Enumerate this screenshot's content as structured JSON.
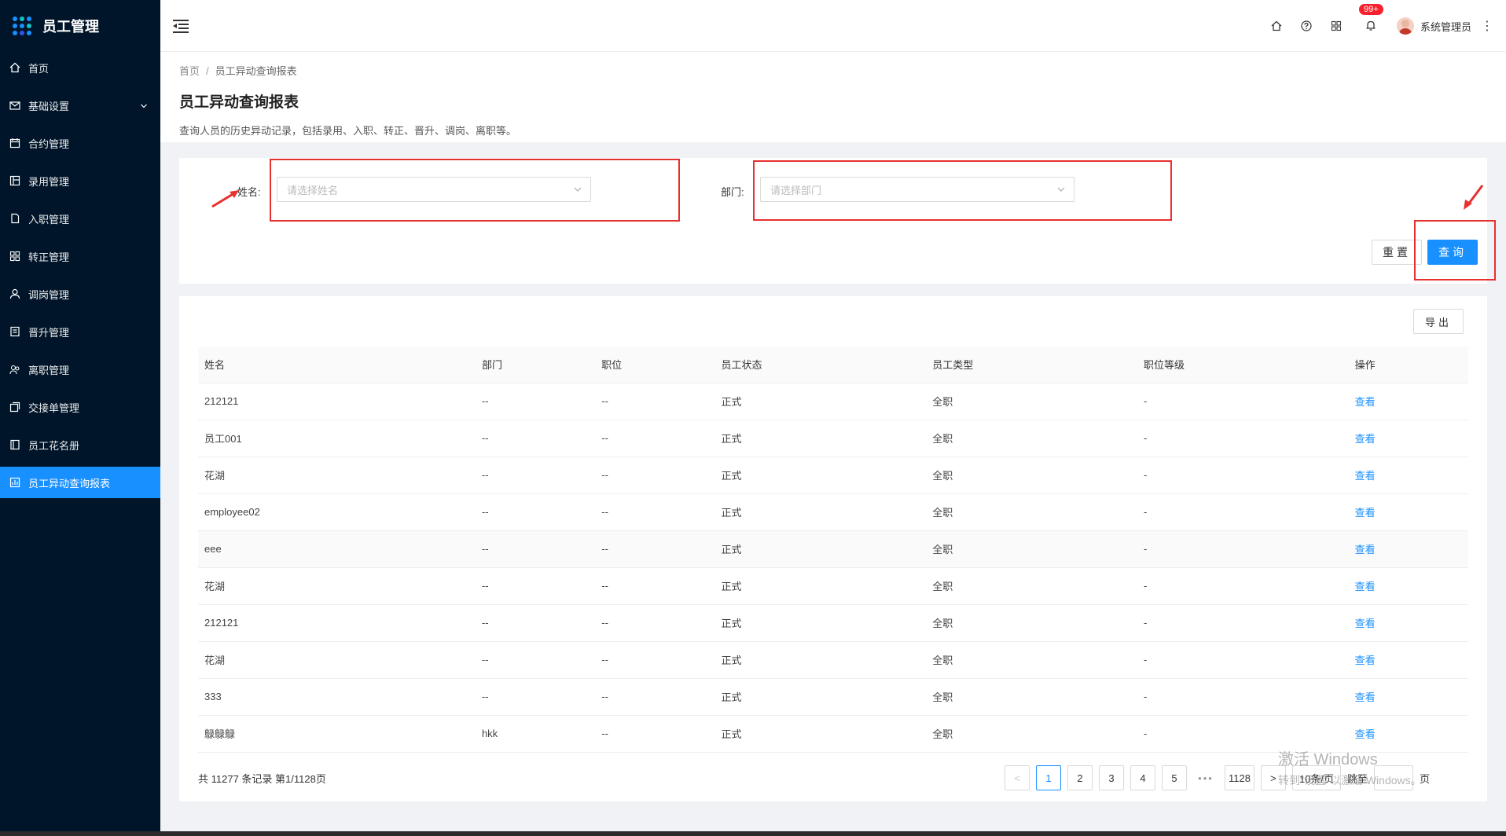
{
  "app": {
    "title": "员工管理"
  },
  "sidebar": {
    "items": [
      {
        "label": "首页",
        "icon": "home-icon"
      },
      {
        "label": "基础设置",
        "icon": "mail-icon",
        "expandable": true
      },
      {
        "label": "合约管理",
        "icon": "calendar-icon"
      },
      {
        "label": "录用管理",
        "icon": "layout-icon"
      },
      {
        "label": "入职管理",
        "icon": "file-icon"
      },
      {
        "label": "转正管理",
        "icon": "grid-icon"
      },
      {
        "label": "调岗管理",
        "icon": "user-icon"
      },
      {
        "label": "晋升管理",
        "icon": "profile-icon"
      },
      {
        "label": "离职管理",
        "icon": "team-icon"
      },
      {
        "label": "交接单管理",
        "icon": "copy-icon"
      },
      {
        "label": "员工花名册",
        "icon": "book-icon"
      },
      {
        "label": "员工异动查询报表",
        "icon": "report-icon",
        "active": true
      }
    ]
  },
  "header": {
    "badge": "99+",
    "username": "系统管理员"
  },
  "breadcrumb": {
    "home": "首页",
    "current": "员工异动查询报表"
  },
  "page": {
    "title": "员工异动查询报表",
    "description": "查询人员的历史异动记录，包括录用、入职、转正、晋升、调岗、离职等。"
  },
  "search": {
    "name_label": "姓名:",
    "name_placeholder": "请选择姓名",
    "dept_label": "部门:",
    "dept_placeholder": "请选择部门",
    "reset_label": "重置",
    "query_label": "查询"
  },
  "table": {
    "export_label": "导出",
    "columns": [
      "姓名",
      "部门",
      "职位",
      "员工状态",
      "员工类型",
      "职位等级",
      "操作"
    ],
    "rows": [
      [
        "212121",
        "--",
        "--",
        "正式",
        "全职",
        "-",
        "查看"
      ],
      [
        "员工001",
        "--",
        "--",
        "正式",
        "全职",
        "-",
        "查看"
      ],
      [
        "花湖",
        "--",
        "--",
        "正式",
        "全职",
        "-",
        "查看"
      ],
      [
        "employee02",
        "--",
        "--",
        "正式",
        "全职",
        "-",
        "查看"
      ],
      [
        "eee",
        "--",
        "--",
        "正式",
        "全职",
        "-",
        "查看"
      ],
      [
        "花湖",
        "--",
        "--",
        "正式",
        "全职",
        "-",
        "查看"
      ],
      [
        "212121",
        "--",
        "--",
        "正式",
        "全职",
        "-",
        "查看"
      ],
      [
        "花湖",
        "--",
        "--",
        "正式",
        "全职",
        "-",
        "查看"
      ],
      [
        "333",
        "--",
        "--",
        "正式",
        "全职",
        "-",
        "查看"
      ],
      [
        "鵦鵦鵦",
        "hkk",
        "--",
        "正式",
        "全职",
        "-",
        "查看"
      ]
    ]
  },
  "pagination": {
    "total_text": "共 11277 条记录 第1/1128页",
    "prev": "<",
    "pages": [
      "1",
      "2",
      "3",
      "4",
      "5"
    ],
    "dots": "•••",
    "last": "1128",
    "next": ">",
    "page_size": "10条/页",
    "jump_label": "跳至",
    "jump_suffix": "页"
  },
  "watermark": {
    "line1": "激活 Windows",
    "line2": "转到\"设置\"以激活 Windows。"
  },
  "colors": {
    "sidebar_bg": "#001529",
    "primary": "#1890ff",
    "annotation_red": "#e8302e",
    "badge_red": "#f5222d"
  }
}
